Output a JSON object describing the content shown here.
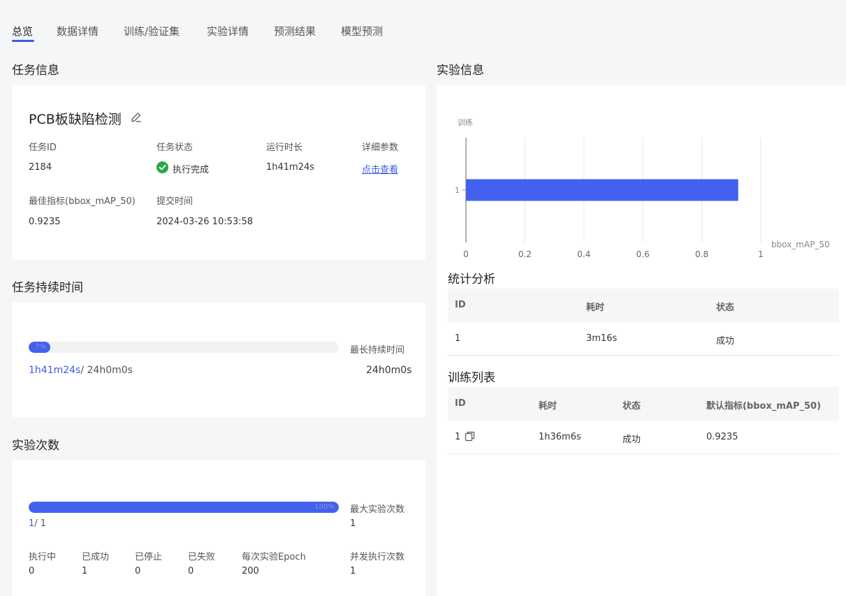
{
  "tabs": [
    "总览",
    "数据详情",
    "训练/验证集",
    "实验详情",
    "预测结果",
    "模型预测"
  ],
  "task_info": {
    "section_title": "任务信息",
    "task_name": "PCB板缺陷检测",
    "task_id_label": "任务ID",
    "task_id": "2184",
    "status_label": "任务状态",
    "status": "执行完成",
    "runtime_label": "运行时长",
    "runtime": "1h41m24s",
    "params_label": "详细参数",
    "params_link": "点击查看",
    "best_metric_label": "最佳指标(bbox_mAP_50)",
    "best_metric": "0.9235",
    "submit_time_label": "提交时间",
    "submit_time": "2024-03-26 10:53:58"
  },
  "duration": {
    "section_title": "任务持续时间",
    "progress_percent": 7,
    "progress_label": "7%",
    "max_label": "最长持续时间",
    "used": "1h41m24s",
    "total": "/ 24h0m0s",
    "max_value": "24h0m0s"
  },
  "experiments": {
    "section_title": "实验次数",
    "progress_percent": 100,
    "progress_label": "100%",
    "max_label": "最大实验次数",
    "current": "1",
    "total": "/ 1",
    "max_value": "1",
    "stats": [
      {
        "label": "执行中",
        "value": "0"
      },
      {
        "label": "已成功",
        "value": "1"
      },
      {
        "label": "已停止",
        "value": "0"
      },
      {
        "label": "已失败",
        "value": "0"
      },
      {
        "label": "每次实验Epoch",
        "value": "200"
      },
      {
        "label": "并发执行次数",
        "value": "1"
      }
    ]
  },
  "experiment_info": {
    "section_title": "实验信息"
  },
  "chart_data": {
    "type": "bar",
    "orientation": "horizontal",
    "title": "训练",
    "categories": [
      "1"
    ],
    "values": [
      0.9235
    ],
    "xlabel": "bbox_mAP_50",
    "ylabel": "",
    "xlim": [
      0,
      1
    ],
    "xticks": [
      "0",
      "0.2",
      "0.4",
      "0.6",
      "0.8",
      "1"
    ],
    "bar_color": "#4361ee",
    "grid": true
  },
  "stats_table": {
    "title": "统计分析",
    "headers": [
      "ID",
      "耗时",
      "状态"
    ],
    "rows": [
      [
        "1",
        "3m16s",
        "成功"
      ]
    ]
  },
  "train_table": {
    "title": "训练列表",
    "headers": [
      "ID",
      "耗时",
      "状态",
      "默认指标(bbox_mAP_50)"
    ],
    "rows": [
      [
        "1",
        "1h36m6s",
        "成功",
        "0.9235"
      ]
    ]
  },
  "colors": {
    "accent": "#3c5ce8",
    "success": "#27a844",
    "bar": "#4361ee"
  }
}
